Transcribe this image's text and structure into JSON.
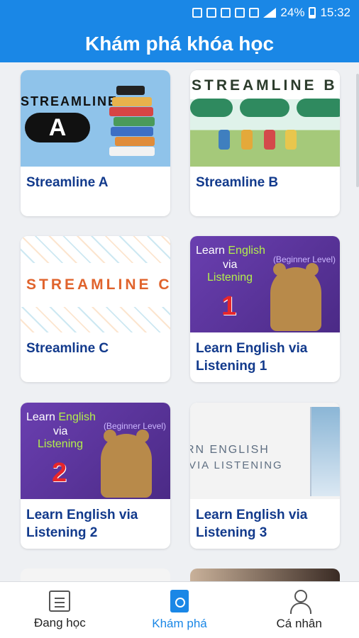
{
  "status": {
    "battery": "24%",
    "time": "15:32"
  },
  "header": {
    "title": "Khám phá khóa học"
  },
  "courses": [
    {
      "title": "Streamline A",
      "thumb_text": "STREAMLINE",
      "thumb_letter": "A"
    },
    {
      "title": "Streamline B",
      "thumb_text": "STREAMLINE B"
    },
    {
      "title": "Streamline C",
      "thumb_text": "STREAMLINE C"
    },
    {
      "title": "Learn English via Listening 1",
      "thumb_learn": "Learn",
      "thumb_english": "English",
      "thumb_via": "via",
      "thumb_listening": "Listening",
      "thumb_level": "(Beginner Level)",
      "thumb_number": "1"
    },
    {
      "title": "Learn English via Listening 2",
      "thumb_learn": "Learn",
      "thumb_english": "English",
      "thumb_via": "via",
      "thumb_listening": "Listening",
      "thumb_level": "(Beginner Level)",
      "thumb_number": "2"
    },
    {
      "title": "Learn English via Listening 3",
      "thumb_line1": "RN ENGLISH",
      "thumb_line2": "VIA LISTENING"
    }
  ],
  "nav": [
    {
      "label": "Đang học",
      "icon": "document-icon"
    },
    {
      "label": "Khám phá",
      "icon": "book-search-icon",
      "active": true
    },
    {
      "label": "Cá nhân",
      "icon": "user-icon"
    }
  ],
  "colors": {
    "primary": "#1a87e6",
    "title_text": "#123a8c"
  }
}
